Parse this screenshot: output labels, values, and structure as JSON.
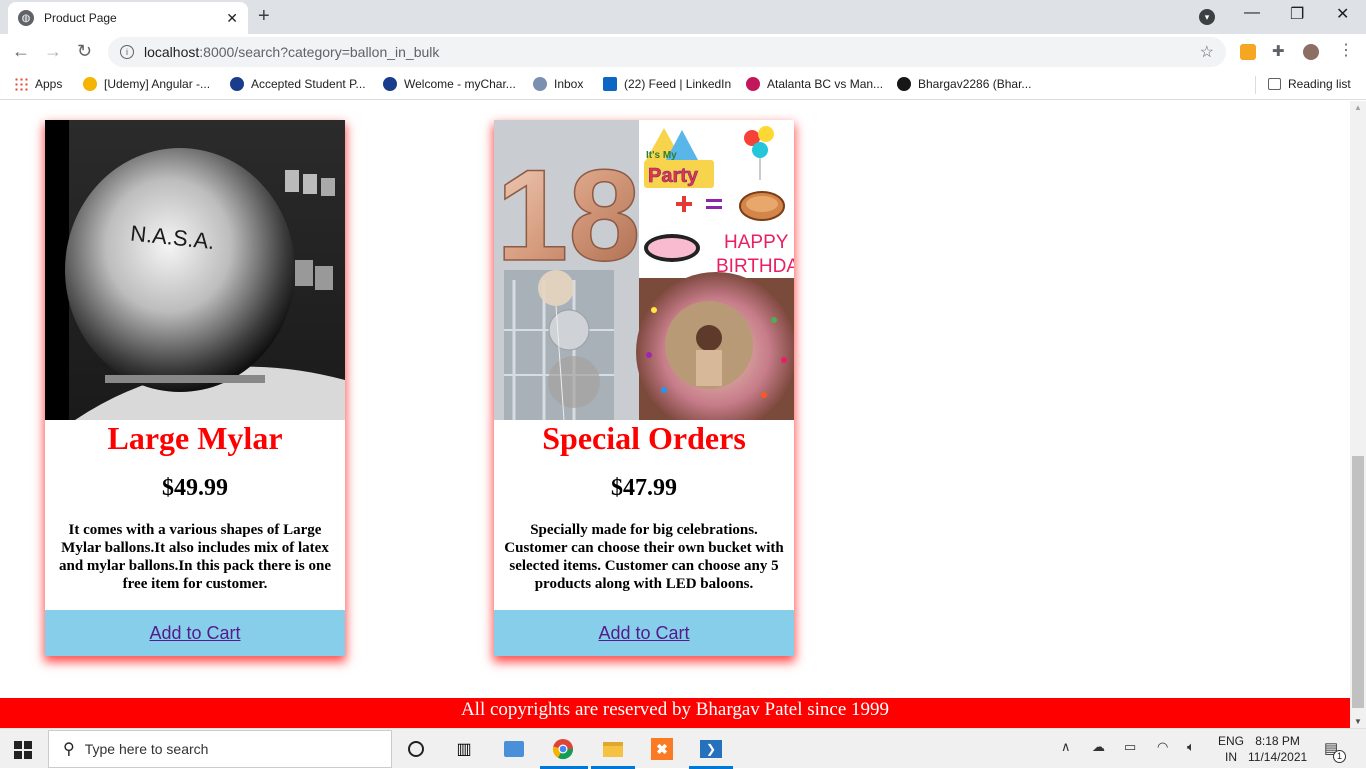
{
  "browser": {
    "tab_title": "Product Page",
    "tab_close": "✕",
    "new_tab": "+",
    "url_host": "localhost",
    "url_rest": ":8000/search?category=ballon_in_bulk",
    "bookmarks": [
      {
        "label": "Apps",
        "color": "#ea4335"
      },
      {
        "label": "[Udemy] Angular -...",
        "color": "#f4b400"
      },
      {
        "label": "Accepted Student P...",
        "color": "#1a3c8c"
      },
      {
        "label": "Welcome - myChar...",
        "color": "#1a3c8c"
      },
      {
        "label": "Inbox",
        "color": "#7b8fb0"
      },
      {
        "label": "(22) Feed | LinkedIn",
        "color": "#0a66c2"
      },
      {
        "label": "Atalanta BC vs Man...",
        "color": "#c2185b"
      },
      {
        "label": "Bhargav2286 (Bhar...",
        "color": "#181717"
      }
    ],
    "reading_list": "Reading list"
  },
  "products": [
    {
      "name": "Large Mylar",
      "price": "$49.99",
      "description": "It comes with a various shapes of Large Mylar ballons.It also includes mix of latex and mylar ballons.In this pack there is one free item for customer.",
      "cta": "Add to Cart",
      "image_text": "N.A.S.A."
    },
    {
      "name": "Special Orders",
      "price": "$47.99",
      "description": "Specially made for big celebrations. Customer can choose their own bucket with selected items. Customer can choose any 5 products along with LED baloons.",
      "cta": "Add to Cart",
      "image_text_number": "18",
      "image_text_party_1": "It's My",
      "image_text_party_2": "Party",
      "image_text_birthday_1": "HAPPY",
      "image_text_birthday_2": "BIRTHDAY"
    }
  ],
  "footer": {
    "text": "All copyrights are reserved by Bhargav Patel since 1999"
  },
  "taskbar": {
    "search_placeholder": "Type here to search",
    "lang_top": "ENG",
    "lang_bottom": "IN",
    "time": "8:18 PM",
    "date": "11/14/2021",
    "notification_count": "1"
  },
  "colors": {
    "accent_red": "#ff0000",
    "cart_blue": "#87ceeb",
    "link_purple": "#551a8b"
  }
}
